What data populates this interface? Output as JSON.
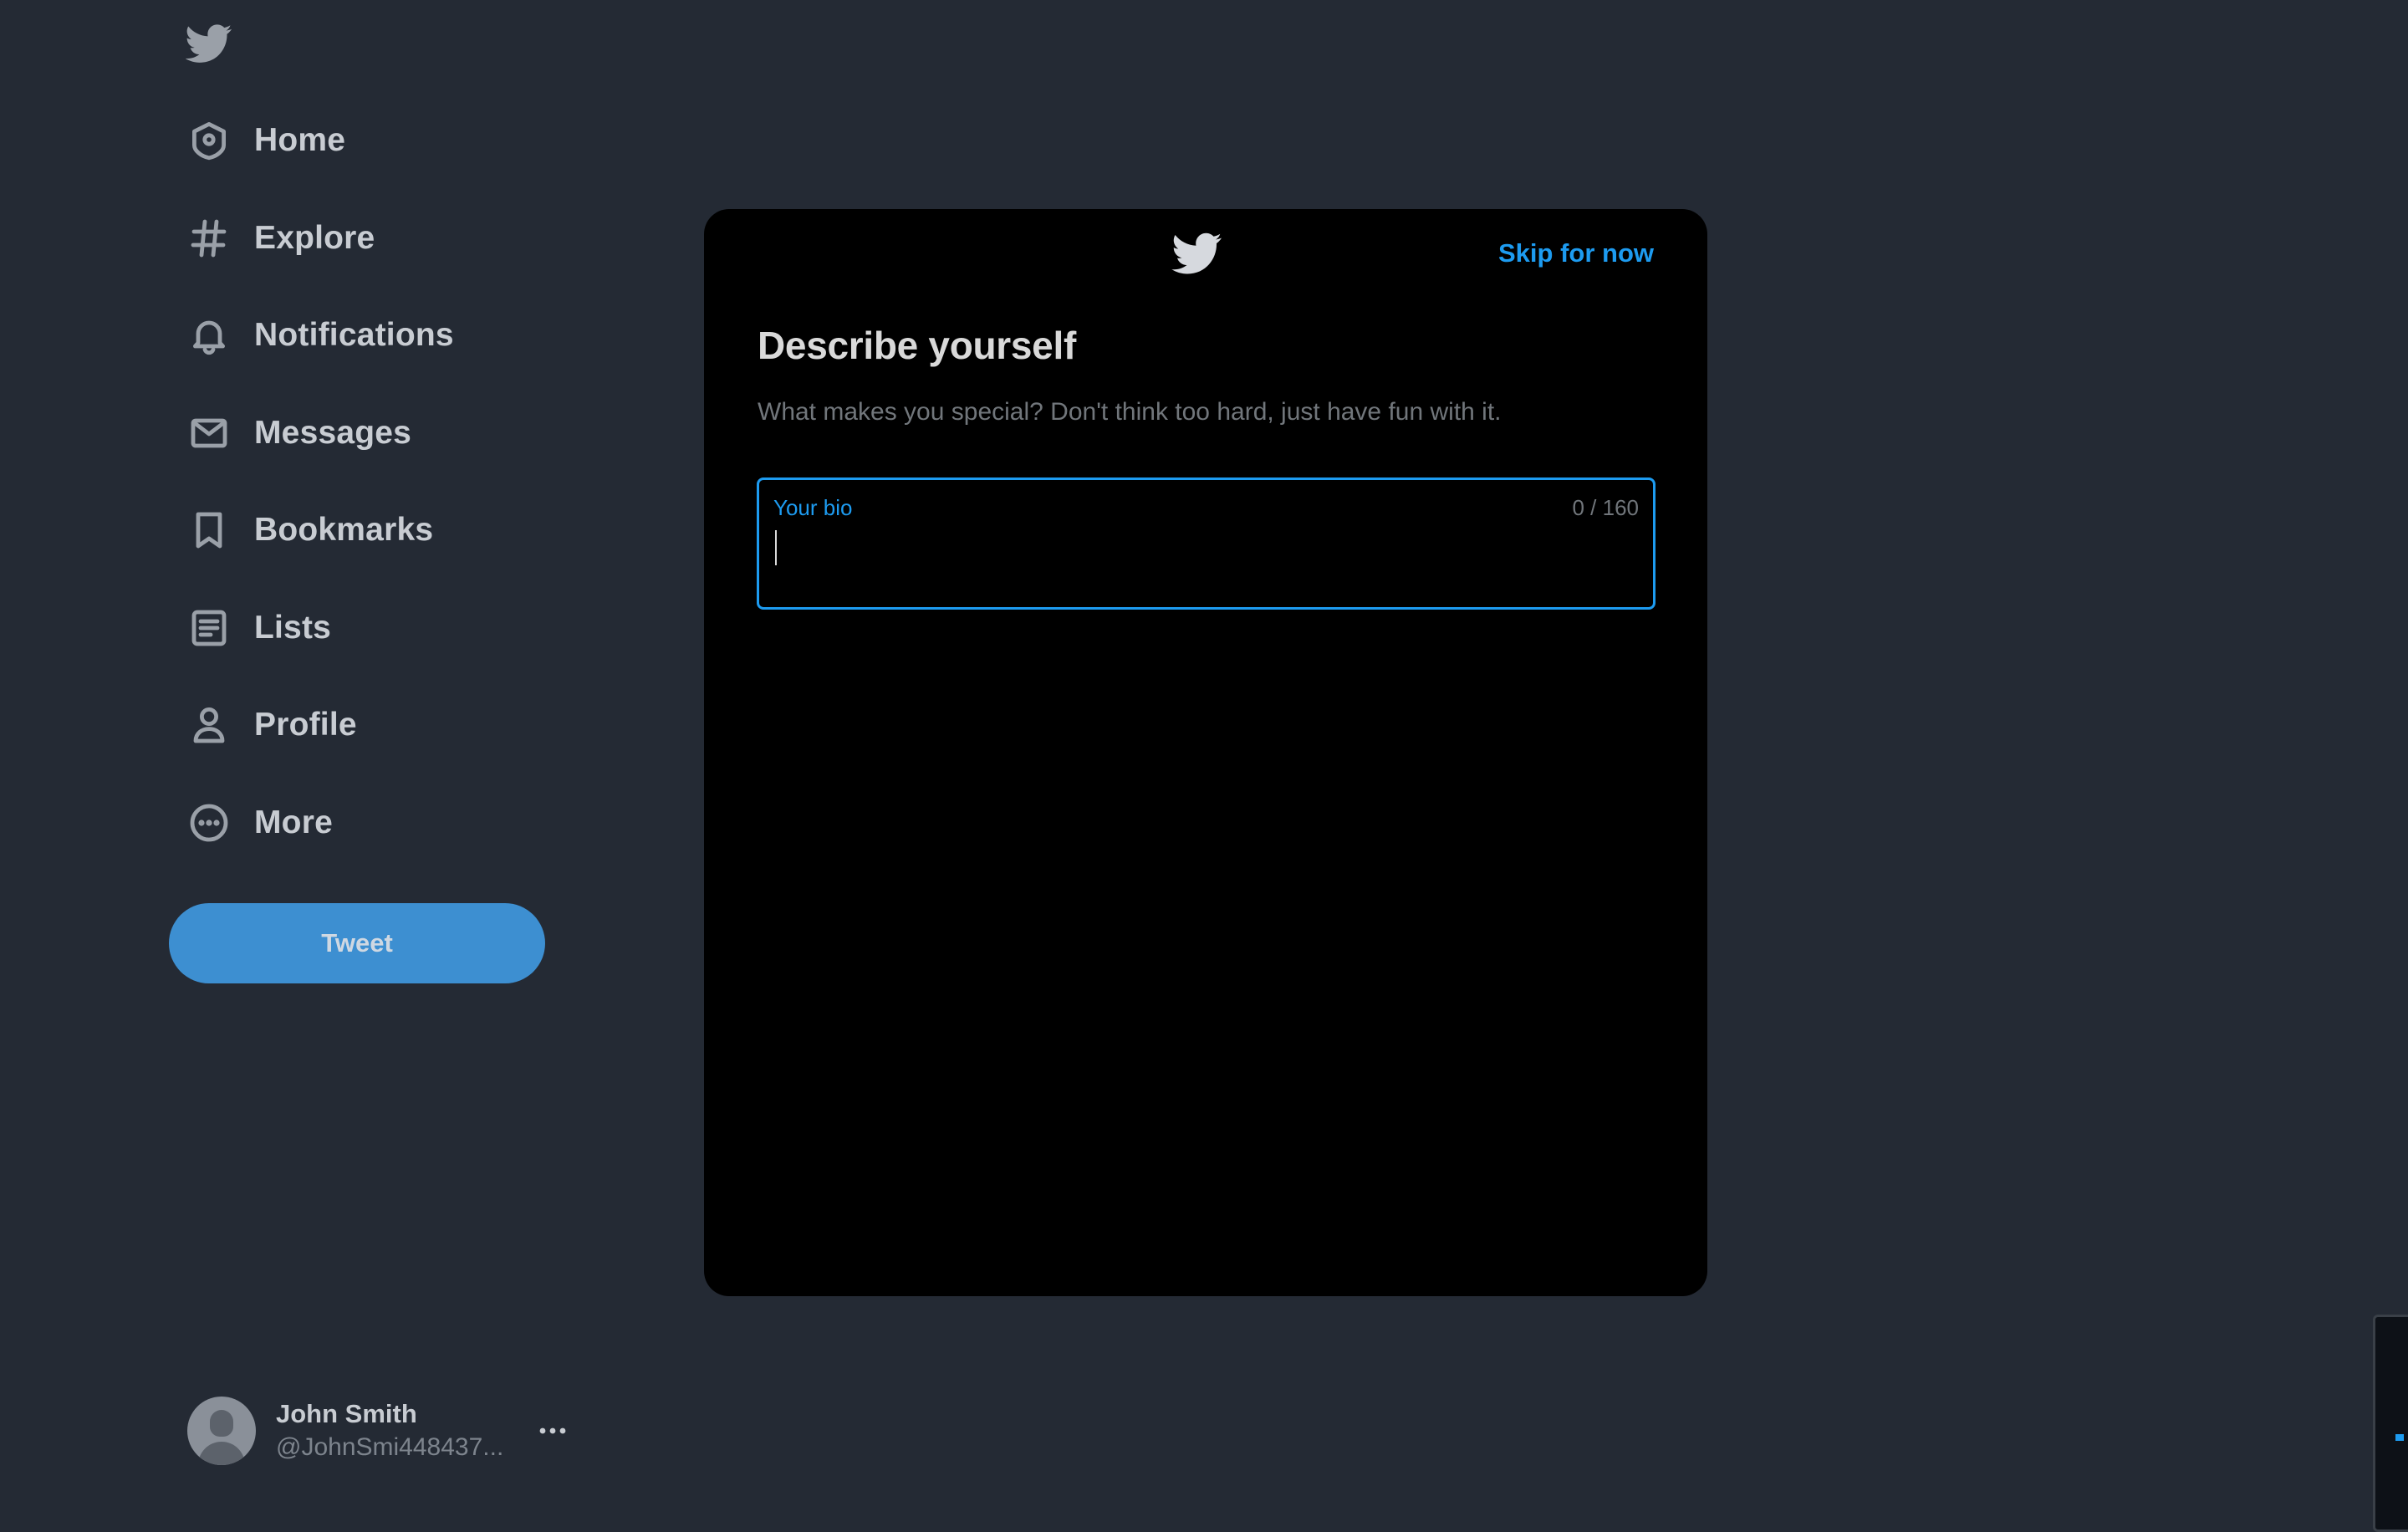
{
  "sidebar": {
    "logo_icon": "twitter-bird-icon",
    "items": [
      {
        "label": "Home",
        "icon": "home-icon"
      },
      {
        "label": "Explore",
        "icon": "hashtag-icon"
      },
      {
        "label": "Notifications",
        "icon": "bell-icon"
      },
      {
        "label": "Messages",
        "icon": "envelope-icon"
      },
      {
        "label": "Bookmarks",
        "icon": "bookmark-icon"
      },
      {
        "label": "Lists",
        "icon": "list-icon"
      },
      {
        "label": "Profile",
        "icon": "person-icon"
      },
      {
        "label": "More",
        "icon": "more-circle-icon"
      }
    ],
    "tweet_button": "Tweet",
    "account": {
      "name": "John Smith",
      "handle": "@JohnSmi448437..."
    }
  },
  "modal": {
    "skip_label": "Skip for now",
    "title": "Describe yourself",
    "subtitle": "What makes you special? Don't think too hard, just have fun with it.",
    "bio": {
      "label": "Your bio",
      "counter": "0 / 160",
      "value": ""
    }
  },
  "colors": {
    "background": "#242a34",
    "modal": "#000000",
    "accent": "#1d9bf0",
    "tweet_button": "#3d8fd1"
  }
}
